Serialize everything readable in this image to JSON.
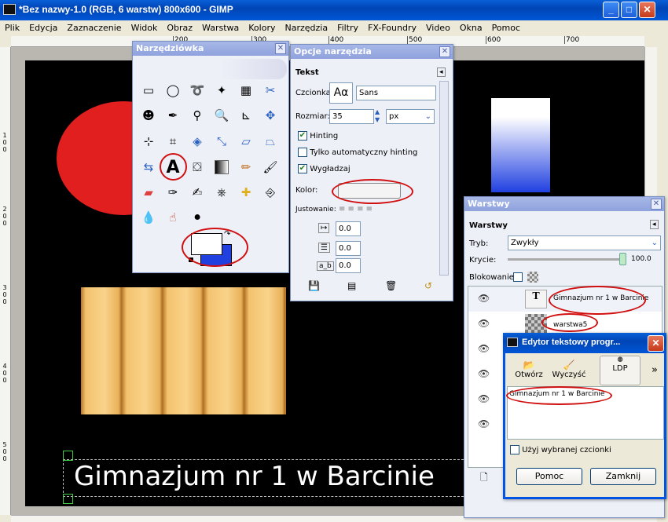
{
  "window": {
    "title": "*Bez nazwy-1.0 (RGB, 6 warstw) 800x600 - GIMP"
  },
  "menu": [
    "Plik",
    "Edycja",
    "Zaznaczenie",
    "Widok",
    "Obraz",
    "Warstwa",
    "Kolory",
    "Narzędzia",
    "Filtry",
    "FX-Foundry",
    "Video",
    "Okna",
    "Pomoc"
  ],
  "ruler": {
    "h_ticks": [
      "200",
      "300",
      "400",
      "500",
      "600",
      "700"
    ],
    "v_ticks": [
      "100",
      "200",
      "300",
      "400",
      "500"
    ]
  },
  "canvas": {
    "text": "Gimnazjum nr 1 w Barcinie"
  },
  "toolbox": {
    "title": "Narzędziówka"
  },
  "tool_options": {
    "title": "Opcje narzędzia",
    "section": "Tekst",
    "font_label": "Czcionka:",
    "font_preview": "Aα",
    "font_value": "Sans",
    "size_label": "Rozmiar:",
    "size_value": "35",
    "unit_value": "px",
    "hinting": "Hinting",
    "auto_hinting": "Tylko automatyczny hinting",
    "antialias": "Wygładzaj",
    "color_label": "Kolor:",
    "justify_label": "Justowanie:",
    "indent_value": "0.0",
    "line_spacing_value": "0.0",
    "letter_spacing_value": "0.0"
  },
  "layers": {
    "title": "Warstwy",
    "section": "Warstwy",
    "mode_label": "Tryb:",
    "mode_value": "Zwykły",
    "opacity_label": "Krycie:",
    "opacity_value": "100.0",
    "lock_label": "Blokowanie:",
    "items": [
      {
        "name": "Gimnazjum nr 1 w Barcinie"
      },
      {
        "name": "warstwa5"
      }
    ]
  },
  "text_editor": {
    "title": "Edytor tekstowy progr...",
    "open": "Otwórz",
    "clear": "Wyczyść",
    "ldp": "LDP",
    "more": "»",
    "content": "Gimnazjum nr 1 w Barcinie",
    "use_font": "Użyj wybranej czcionki",
    "help": "Pomoc",
    "close": "Zamknij"
  },
  "colors": {
    "xp_blue": "#0054e3",
    "fg": "#ffffff",
    "bg": "#2040e0",
    "red_circle": "#e21f1f",
    "highlight": "#d01010"
  }
}
